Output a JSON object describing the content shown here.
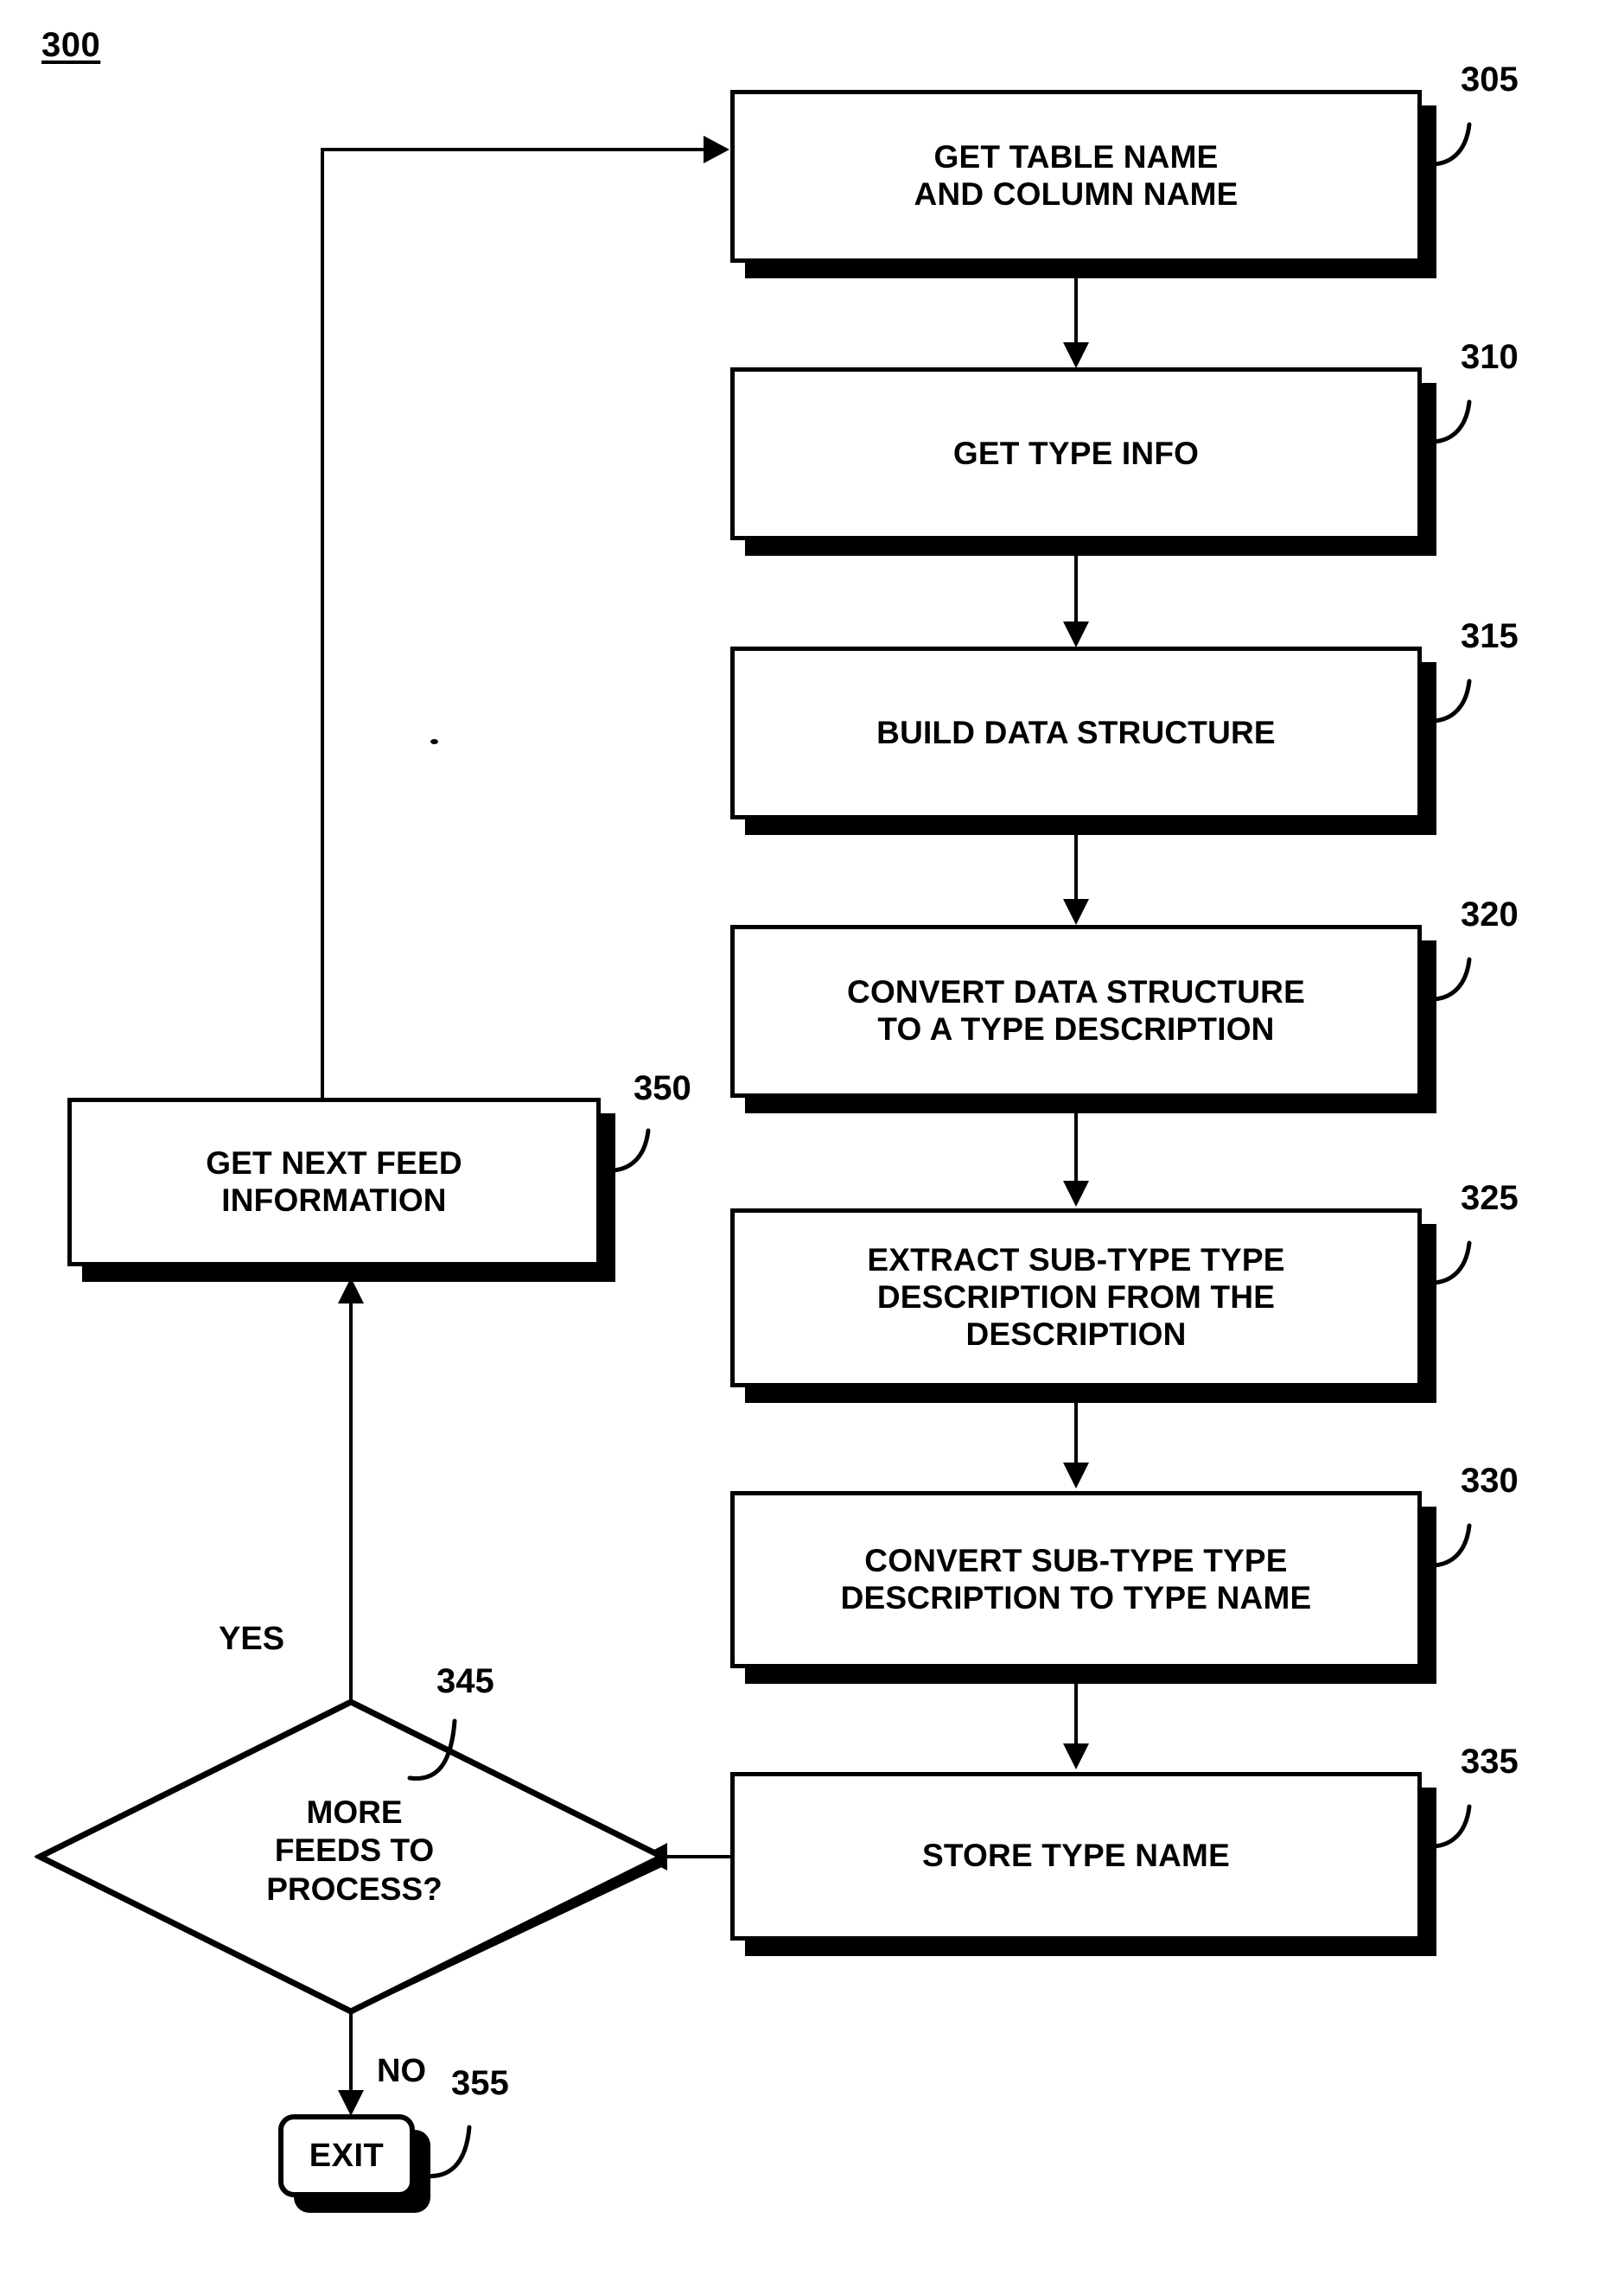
{
  "figure": {
    "number": "300",
    "title": "300"
  },
  "nodes": [
    {
      "id": "305",
      "ref": "305",
      "kind": "process",
      "label": "GET TABLE NAME\nAND COLUMN NAME"
    },
    {
      "id": "310",
      "ref": "310",
      "kind": "process",
      "label": "GET TYPE INFO"
    },
    {
      "id": "315",
      "ref": "315",
      "kind": "process",
      "label": "BUILD DATA STRUCTURE"
    },
    {
      "id": "320",
      "ref": "320",
      "kind": "process",
      "label": "CONVERT DATA STRUCTURE\nTO A TYPE DESCRIPTION"
    },
    {
      "id": "325",
      "ref": "325",
      "kind": "process",
      "label": "EXTRACT SUB-TYPE TYPE\nDESCRIPTION FROM THE\nDESCRIPTION"
    },
    {
      "id": "330",
      "ref": "330",
      "kind": "process",
      "label": "CONVERT SUB-TYPE TYPE\nDESCRIPTION TO TYPE NAME"
    },
    {
      "id": "335",
      "ref": "335",
      "kind": "process",
      "label": "STORE TYPE NAME"
    },
    {
      "id": "345",
      "ref": "345",
      "kind": "decision",
      "label": "MORE\nFEEDS TO\nPROCESS?"
    },
    {
      "id": "350",
      "ref": "350",
      "kind": "process",
      "label": "GET NEXT FEED\nINFORMATION"
    },
    {
      "id": "355",
      "ref": "355",
      "kind": "terminator",
      "label": "EXIT"
    }
  ],
  "branches": {
    "yes": "YES",
    "no": "NO"
  },
  "colors": {
    "stroke": "#000000",
    "fill": "#ffffff",
    "shadow": "#000000"
  }
}
